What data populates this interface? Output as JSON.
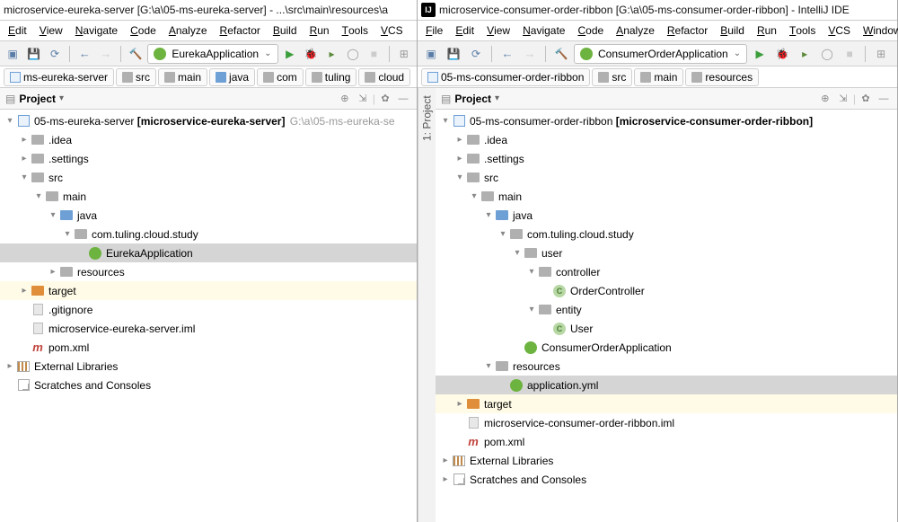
{
  "left": {
    "title": "microservice-eureka-server [G:\\a\\05-ms-eureka-server] - ...\\src\\main\\resources\\a",
    "menu": [
      "Edit",
      "View",
      "Navigate",
      "Code",
      "Analyze",
      "Refactor",
      "Build",
      "Run",
      "Tools",
      "VCS"
    ],
    "run_config": "EurekaApplication",
    "breadcrumbs": [
      "ms-eureka-server",
      "src",
      "main",
      "java",
      "com",
      "tuling",
      "cloud"
    ],
    "panel_title": "Project",
    "tree": [
      {
        "d": 0,
        "tw": "open",
        "icon": "module",
        "text": "05-ms-eureka-server",
        "bold": "[microservice-eureka-server]",
        "grey": " G:\\a\\05-ms-eureka-se"
      },
      {
        "d": 1,
        "tw": "closed",
        "icon": "folder-grey",
        "text": ".idea"
      },
      {
        "d": 1,
        "tw": "closed",
        "icon": "folder-grey",
        "text": ".settings"
      },
      {
        "d": 1,
        "tw": "open",
        "icon": "folder-grey",
        "text": "src"
      },
      {
        "d": 2,
        "tw": "open",
        "icon": "folder-grey",
        "text": "main"
      },
      {
        "d": 3,
        "tw": "open",
        "icon": "folder-blue",
        "text": "java"
      },
      {
        "d": 4,
        "tw": "open",
        "icon": "folder-grey",
        "text": "com.tuling.cloud.study"
      },
      {
        "d": 5,
        "tw": "",
        "icon": "spring",
        "text": "EurekaApplication",
        "selected": true
      },
      {
        "d": 3,
        "tw": "closed",
        "icon": "folder-grey",
        "text": "resources"
      },
      {
        "d": 1,
        "tw": "closed",
        "icon": "folder-orange",
        "text": "target",
        "hl": true
      },
      {
        "d": 1,
        "tw": "",
        "icon": "file",
        "text": ".gitignore"
      },
      {
        "d": 1,
        "tw": "",
        "icon": "file",
        "text": "microservice-eureka-server.iml"
      },
      {
        "d": 1,
        "tw": "",
        "icon": "m",
        "text": "pom.xml"
      },
      {
        "d": 0,
        "tw": "closed",
        "icon": "lib",
        "text": "External Libraries"
      },
      {
        "d": 0,
        "tw": "",
        "icon": "scratch",
        "text": "Scratches and Consoles"
      }
    ]
  },
  "right": {
    "title": "microservice-consumer-order-ribbon [G:\\a\\05-ms-consumer-order-ribbon] - IntelliJ IDE",
    "menu": [
      "File",
      "Edit",
      "View",
      "Navigate",
      "Code",
      "Analyze",
      "Refactor",
      "Build",
      "Run",
      "Tools",
      "VCS",
      "Window"
    ],
    "run_config": "ConsumerOrderApplication",
    "breadcrumbs": [
      "05-ms-consumer-order-ribbon",
      "src",
      "main",
      "resources"
    ],
    "panel_title": "Project",
    "side_tab": "1: Project",
    "tree": [
      {
        "d": 0,
        "tw": "open",
        "icon": "module",
        "text": "05-ms-consumer-order-ribbon",
        "bold": "[microservice-consumer-order-ribbon]"
      },
      {
        "d": 1,
        "tw": "closed",
        "icon": "folder-grey",
        "text": ".idea"
      },
      {
        "d": 1,
        "tw": "closed",
        "icon": "folder-grey",
        "text": ".settings"
      },
      {
        "d": 1,
        "tw": "open",
        "icon": "folder-grey",
        "text": "src"
      },
      {
        "d": 2,
        "tw": "open",
        "icon": "folder-grey",
        "text": "main"
      },
      {
        "d": 3,
        "tw": "open",
        "icon": "folder-blue",
        "text": "java"
      },
      {
        "d": 4,
        "tw": "open",
        "icon": "folder-grey",
        "text": "com.tuling.cloud.study"
      },
      {
        "d": 5,
        "tw": "open",
        "icon": "folder-grey",
        "text": "user"
      },
      {
        "d": 6,
        "tw": "open",
        "icon": "folder-grey",
        "text": "controller"
      },
      {
        "d": 7,
        "tw": "",
        "icon": "c",
        "text": "OrderController"
      },
      {
        "d": 6,
        "tw": "open",
        "icon": "folder-grey",
        "text": "entity"
      },
      {
        "d": 7,
        "tw": "",
        "icon": "c",
        "text": "User"
      },
      {
        "d": 5,
        "tw": "",
        "icon": "spring",
        "text": "ConsumerOrderApplication"
      },
      {
        "d": 3,
        "tw": "open",
        "icon": "folder-grey",
        "text": "resources"
      },
      {
        "d": 4,
        "tw": "",
        "icon": "spring",
        "text": "application.yml",
        "selected": true
      },
      {
        "d": 1,
        "tw": "closed",
        "icon": "folder-orange",
        "text": "target",
        "hl": true
      },
      {
        "d": 1,
        "tw": "",
        "icon": "file",
        "text": "microservice-consumer-order-ribbon.iml"
      },
      {
        "d": 1,
        "tw": "",
        "icon": "m",
        "text": "pom.xml"
      },
      {
        "d": 0,
        "tw": "closed",
        "icon": "lib",
        "text": "External Libraries"
      },
      {
        "d": 0,
        "tw": "closed",
        "icon": "scratch",
        "text": "Scratches and Consoles"
      }
    ]
  }
}
